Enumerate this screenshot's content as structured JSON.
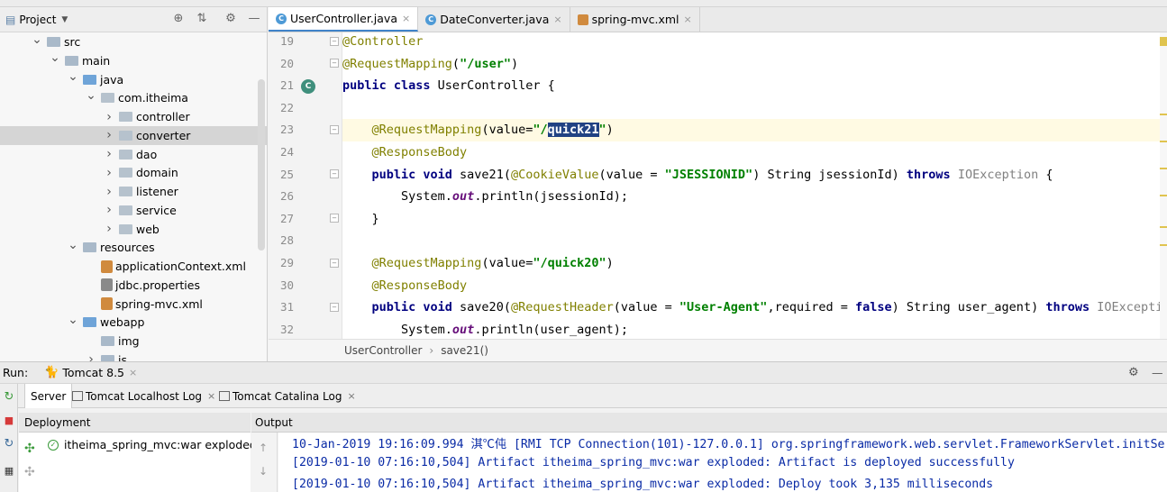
{
  "project": {
    "title": "Project",
    "tree": [
      {
        "label": "src",
        "depth": 0,
        "arrow": "v",
        "kind": "folder"
      },
      {
        "label": "main",
        "depth": 1,
        "arrow": "v",
        "kind": "folder"
      },
      {
        "label": "java",
        "depth": 2,
        "arrow": "v",
        "kind": "blue"
      },
      {
        "label": "com.itheima",
        "depth": 3,
        "arrow": "v",
        "kind": "pkg"
      },
      {
        "label": "controller",
        "depth": 4,
        "arrow": ">",
        "kind": "pkg"
      },
      {
        "label": "converter",
        "depth": 4,
        "arrow": ">",
        "kind": "pkg",
        "selected": true
      },
      {
        "label": "dao",
        "depth": 4,
        "arrow": ">",
        "kind": "pkg"
      },
      {
        "label": "domain",
        "depth": 4,
        "arrow": ">",
        "kind": "pkg"
      },
      {
        "label": "listener",
        "depth": 4,
        "arrow": ">",
        "kind": "pkg"
      },
      {
        "label": "service",
        "depth": 4,
        "arrow": ">",
        "kind": "pkg"
      },
      {
        "label": "web",
        "depth": 4,
        "arrow": ">",
        "kind": "pkg"
      },
      {
        "label": "resources",
        "depth": 2,
        "arrow": "v",
        "kind": "res"
      },
      {
        "label": "applicationContext.xml",
        "depth": 3,
        "arrow": "",
        "kind": "xml"
      },
      {
        "label": "jdbc.properties",
        "depth": 3,
        "arrow": "",
        "kind": "prop"
      },
      {
        "label": "spring-mvc.xml",
        "depth": 3,
        "arrow": "",
        "kind": "xml"
      },
      {
        "label": "webapp",
        "depth": 2,
        "arrow": "v",
        "kind": "blue"
      },
      {
        "label": "img",
        "depth": 3,
        "arrow": "",
        "kind": "folder"
      },
      {
        "label": "js",
        "depth": 3,
        "arrow": ">",
        "kind": "folder"
      }
    ]
  },
  "tabs": [
    {
      "label": "UserController.java",
      "icon": "class",
      "active": true
    },
    {
      "label": "DateConverter.java",
      "icon": "class",
      "active": false
    },
    {
      "label": "spring-mvc.xml",
      "icon": "xml",
      "active": false
    }
  ],
  "editor": {
    "line_numbers": [
      "19",
      "20",
      "21",
      "22",
      "23",
      "24",
      "25",
      "26",
      "27",
      "28",
      "29",
      "30",
      "31",
      "32"
    ],
    "breadcrumb": {
      "class": "UserController",
      "method": "save21()",
      "sep": "›"
    }
  },
  "run": {
    "label": "Run:",
    "config": "Tomcat 8.5",
    "tabs": [
      "Server",
      "Tomcat Localhost Log",
      "Tomcat Catalina Log"
    ],
    "deployment_header": "Deployment",
    "output_header": "Output",
    "deployment_item": "itheima_spring_mvc:war exploded",
    "output_lines": [
      "10-Jan-2019 19:16:09.994 淇℃伅 [RMI TCP Connection(101)-127.0.0.1] org.springframework.web.servlet.FrameworkServlet.initSe",
      "[2019-01-10 07:16:10,504] Artifact itheima_spring_mvc:war exploded: Artifact is deployed successfully",
      "[2019-01-10 07:16:10,504] Artifact itheima_spring_mvc:war exploded: Deploy took 3,135 milliseconds"
    ]
  }
}
